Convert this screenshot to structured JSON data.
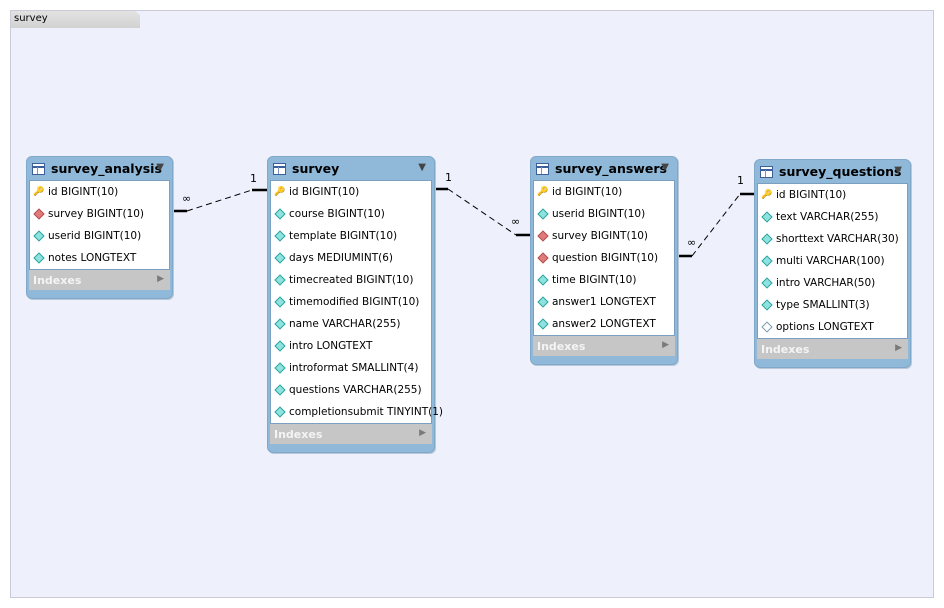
{
  "layer": {
    "label": "survey"
  },
  "tables": {
    "survey_analysis": {
      "title": "survey_analysis",
      "columns": [
        {
          "text": "id BIGINT(10)",
          "icon": "key-icon"
        },
        {
          "text": "survey BIGINT(10)",
          "icon": "foreign-key-icon"
        },
        {
          "text": "userid BIGINT(10)",
          "icon": "column-icon"
        },
        {
          "text": "notes LONGTEXT",
          "icon": "column-icon"
        }
      ],
      "indexes": "Indexes"
    },
    "survey": {
      "title": "survey",
      "columns": [
        {
          "text": "id BIGINT(10)",
          "icon": "key-icon"
        },
        {
          "text": "course BIGINT(10)",
          "icon": "column-icon"
        },
        {
          "text": "template BIGINT(10)",
          "icon": "column-icon"
        },
        {
          "text": "days MEDIUMINT(6)",
          "icon": "column-icon"
        },
        {
          "text": "timecreated BIGINT(10)",
          "icon": "column-icon"
        },
        {
          "text": "timemodified BIGINT(10)",
          "icon": "column-icon"
        },
        {
          "text": "name VARCHAR(255)",
          "icon": "column-icon"
        },
        {
          "text": "intro LONGTEXT",
          "icon": "column-icon"
        },
        {
          "text": "introformat SMALLINT(4)",
          "icon": "column-icon"
        },
        {
          "text": "questions VARCHAR(255)",
          "icon": "column-icon"
        },
        {
          "text": "completionsubmit TINYINT(1)",
          "icon": "column-icon"
        }
      ],
      "indexes": "Indexes"
    },
    "survey_answers": {
      "title": "survey_answers",
      "columns": [
        {
          "text": "id BIGINT(10)",
          "icon": "key-icon"
        },
        {
          "text": "userid BIGINT(10)",
          "icon": "column-icon"
        },
        {
          "text": "survey BIGINT(10)",
          "icon": "foreign-key-icon"
        },
        {
          "text": "question BIGINT(10)",
          "icon": "foreign-key-icon"
        },
        {
          "text": "time BIGINT(10)",
          "icon": "column-icon"
        },
        {
          "text": "answer1 LONGTEXT",
          "icon": "column-icon"
        },
        {
          "text": "answer2 LONGTEXT",
          "icon": "column-icon"
        }
      ],
      "indexes": "Indexes"
    },
    "survey_questions": {
      "title": "survey_questions",
      "columns": [
        {
          "text": "id BIGINT(10)",
          "icon": "key-icon"
        },
        {
          "text": "text VARCHAR(255)",
          "icon": "column-icon"
        },
        {
          "text": "shorttext VARCHAR(30)",
          "icon": "column-icon"
        },
        {
          "text": "multi VARCHAR(100)",
          "icon": "column-icon"
        },
        {
          "text": "intro VARCHAR(50)",
          "icon": "column-icon"
        },
        {
          "text": "type SMALLINT(3)",
          "icon": "column-icon"
        },
        {
          "text": "options LONGTEXT",
          "icon": "nullable-column-icon"
        }
      ],
      "indexes": "Indexes"
    }
  },
  "relations": [
    {
      "from": "survey_analysis",
      "to": "survey",
      "many": "∞",
      "one": "1"
    },
    {
      "from": "survey_answers",
      "to": "survey",
      "many": "∞",
      "one": "1"
    },
    {
      "from": "survey_answers",
      "to": "survey_questions",
      "many": "∞",
      "one": "1"
    }
  ],
  "colors": {
    "header": "#8fb8d9",
    "canvas": "#eef0fc",
    "indexes": "#c6c6c6"
  }
}
